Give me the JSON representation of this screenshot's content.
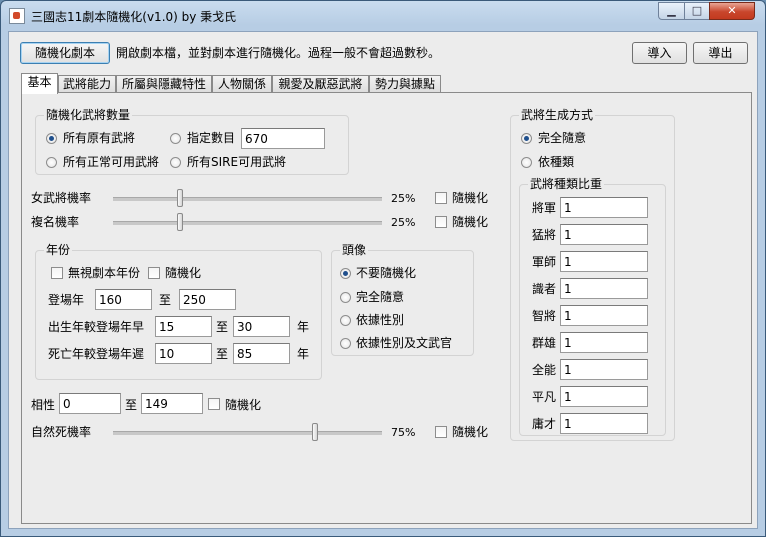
{
  "window": {
    "title": "三國志11劇本隨機化(v1.0) by 秉戈氏",
    "min_glyph": "▁",
    "max_glyph": "□",
    "close_glyph": "✕"
  },
  "toolbar": {
    "randomize_button": "隨機化劇本",
    "description": "開啟劇本檔，並對劇本進行隨機化。過程一般不會超過數秒。",
    "import_button": "導入",
    "export_button": "導出"
  },
  "tabs": [
    "基本",
    "武將能力",
    "所屬與隱藏特性",
    "人物關係",
    "親愛及厭惡武將",
    "勢力與據點"
  ],
  "general_count": {
    "title": "隨機化武將數量",
    "opt_all_original": "所有原有武將",
    "opt_specified": "指定數目",
    "specified_value": "670",
    "opt_all_normal": "所有正常可用武將",
    "opt_all_sire": "所有SIRE可用武將"
  },
  "female_rate": {
    "label": "女武將機率",
    "value": 25,
    "value_text": "25%",
    "random_label": "隨機化"
  },
  "dup_name_rate": {
    "label": "複名機率",
    "value": 25,
    "value_text": "25%",
    "random_label": "隨機化"
  },
  "year": {
    "title": "年份",
    "ignore_label": "無視劇本年份",
    "random_label": "隨機化",
    "appear_label": "登場年",
    "appear_from": "160",
    "to_label": "至",
    "appear_to": "250",
    "birth_label": "出生年較登場年早",
    "birth_from": "15",
    "birth_to": "30",
    "year_unit": "年",
    "death_label": "死亡年較登場年遲",
    "death_from": "10",
    "death_to": "85"
  },
  "portrait": {
    "title": "頭像",
    "opt_none": "不要隨機化",
    "opt_full": "完全隨意",
    "opt_gender": "依據性別",
    "opt_gender_role": "依據性別及文武官"
  },
  "affinity": {
    "label": "相性",
    "from": "0",
    "to_label": "至",
    "to": "149",
    "random_label": "隨機化"
  },
  "natural_death_rate": {
    "label": "自然死機率",
    "value": 75,
    "value_text": "75%",
    "random_label": "隨機化"
  },
  "gen_method": {
    "title": "武將生成方式",
    "opt_full_random": "完全隨意",
    "opt_by_type": "依種類",
    "weight_title": "武將種類比重",
    "types": [
      {
        "name": "將軍",
        "value": "1"
      },
      {
        "name": "猛將",
        "value": "1"
      },
      {
        "name": "軍師",
        "value": "1"
      },
      {
        "name": "識者",
        "value": "1"
      },
      {
        "name": "智將",
        "value": "1"
      },
      {
        "name": "群雄",
        "value": "1"
      },
      {
        "name": "全能",
        "value": "1"
      },
      {
        "name": "平凡",
        "value": "1"
      },
      {
        "name": "庸才",
        "value": "1"
      }
    ]
  },
  "colors": {
    "accent": "#1f4f8c",
    "title_bar": "#b7cde4",
    "panel": "#ececec"
  }
}
